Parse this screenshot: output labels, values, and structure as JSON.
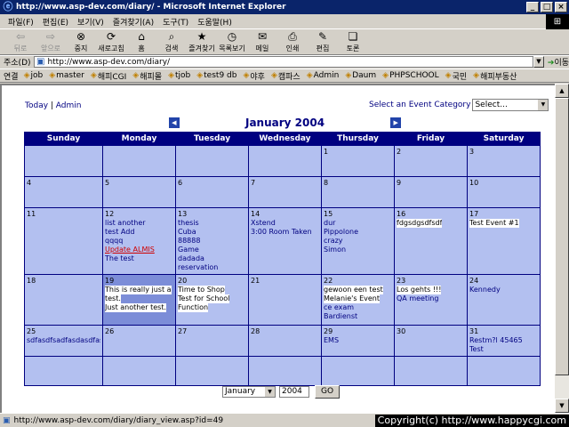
{
  "window": {
    "title": "http://www.asp-dev.com/diary/ - Microsoft Internet Explorer"
  },
  "menu": [
    "파일(F)",
    "편집(E)",
    "보기(V)",
    "즐겨찾기(A)",
    "도구(T)",
    "도움말(H)"
  ],
  "toolbar": [
    {
      "label": "뒤로",
      "icon": "back-arrow-icon",
      "glyph": "⇦",
      "enabled": false
    },
    {
      "label": "앞으로",
      "icon": "forward-arrow-icon",
      "glyph": "⇨",
      "enabled": false
    },
    {
      "label": "중지",
      "icon": "stop-icon",
      "glyph": "⊗",
      "enabled": true
    },
    {
      "label": "새로고침",
      "icon": "refresh-icon",
      "glyph": "⟳",
      "enabled": true
    },
    {
      "label": "홈",
      "icon": "home-icon",
      "glyph": "⌂",
      "enabled": true
    },
    {
      "label": "검색",
      "icon": "search-icon",
      "glyph": "⌕",
      "enabled": true
    },
    {
      "label": "즐겨찾기",
      "icon": "favorites-icon",
      "glyph": "★",
      "enabled": true
    },
    {
      "label": "목록보기",
      "icon": "history-icon",
      "glyph": "◷",
      "enabled": true
    },
    {
      "label": "메일",
      "icon": "mail-icon",
      "glyph": "✉",
      "enabled": true
    },
    {
      "label": "인쇄",
      "icon": "print-icon",
      "glyph": "⎙",
      "enabled": true
    },
    {
      "label": "편집",
      "icon": "edit-icon",
      "glyph": "✎",
      "enabled": true
    },
    {
      "label": "토론",
      "icon": "discuss-icon",
      "glyph": "❏",
      "enabled": true
    }
  ],
  "address": {
    "label": "주소(D)",
    "url": "http://www.asp-dev.com/diary/",
    "go_label": "이동"
  },
  "links": {
    "label": "연결",
    "items": [
      "job",
      "master",
      "해피CGI",
      "해피몰",
      "tjob",
      "test9 db",
      "야후",
      "캠파스",
      "Admin",
      "Daum",
      "PHPSCHOOL",
      "국민",
      "해피부동산"
    ]
  },
  "page": {
    "today_link": "Today",
    "separator": " | ",
    "admin_link": "Admin",
    "category_label": "Select an Event Category",
    "category_value": "Select...",
    "month_title": "January 2004",
    "prev_glyph": "◀",
    "next_glyph": "▶",
    "day_headers": [
      "Sunday",
      "Monday",
      "Tuesday",
      "Wednesday",
      "Thursday",
      "Friday",
      "Saturday"
    ],
    "weeks": [
      [
        {
          "day": "",
          "events": []
        },
        {
          "day": "",
          "events": []
        },
        {
          "day": "",
          "events": []
        },
        {
          "day": "",
          "events": []
        },
        {
          "day": "1",
          "events": []
        },
        {
          "day": "2",
          "events": []
        },
        {
          "day": "3",
          "events": []
        }
      ],
      [
        {
          "day": "4",
          "events": []
        },
        {
          "day": "5",
          "events": []
        },
        {
          "day": "6",
          "events": []
        },
        {
          "day": "7",
          "events": []
        },
        {
          "day": "8",
          "events": []
        },
        {
          "day": "9",
          "events": []
        },
        {
          "day": "10",
          "events": []
        }
      ],
      [
        {
          "day": "11",
          "events": []
        },
        {
          "day": "12",
          "events": [
            {
              "text": "list another"
            },
            {
              "text": "test Add"
            },
            {
              "text": "qqqq"
            },
            {
              "text": "Update ALMIS",
              "style": "red"
            },
            {
              "text": "The test"
            }
          ]
        },
        {
          "day": "13",
          "events": [
            {
              "text": "thesis"
            },
            {
              "text": "Cuba"
            },
            {
              "text": "88888"
            },
            {
              "text": "Game"
            },
            {
              "text": "dadada"
            },
            {
              "text": "reservation"
            }
          ]
        },
        {
          "day": "14",
          "events": [
            {
              "text": "Xstend"
            },
            {
              "text": "3:00 Room Taken"
            }
          ]
        },
        {
          "day": "15",
          "events": [
            {
              "text": "dur"
            },
            {
              "text": "Pippolone"
            },
            {
              "text": "crazy"
            },
            {
              "text": "Simon"
            }
          ]
        },
        {
          "day": "16",
          "events": [
            {
              "text": "fdgsdgsdfsdf",
              "style": "hl"
            }
          ]
        },
        {
          "day": "17",
          "events": [
            {
              "text": "Test Event #1",
              "style": "hl"
            }
          ]
        }
      ],
      [
        {
          "day": "18",
          "events": []
        },
        {
          "day": "19",
          "today": true,
          "events": [
            {
              "text": "This is really just a",
              "style": "hl"
            },
            {
              "text": "test.",
              "style": "hl"
            },
            {
              "text": "Just another test.",
              "style": "hl"
            }
          ]
        },
        {
          "day": "20",
          "events": [
            {
              "text": "Time to Shop",
              "style": "hl"
            },
            {
              "text": "Test for School",
              "style": "hl"
            },
            {
              "text": "Function",
              "style": "hl"
            }
          ]
        },
        {
          "day": "21",
          "events": []
        },
        {
          "day": "22",
          "events": [
            {
              "text": "gewoon een test",
              "style": "hl"
            },
            {
              "text": "Melanie's Event",
              "style": "hl"
            },
            {
              "text": "ce exam"
            },
            {
              "text": "Bardienst"
            }
          ]
        },
        {
          "day": "23",
          "events": [
            {
              "text": "Los gehts !!!",
              "style": "hl"
            },
            {
              "text": "QA meeting"
            }
          ]
        },
        {
          "day": "24",
          "events": [
            {
              "text": "Kennedy"
            }
          ]
        }
      ],
      [
        {
          "day": "25",
          "events": [
            {
              "text": "sdfasdfsadfasdasdfasd"
            }
          ]
        },
        {
          "day": "26",
          "events": []
        },
        {
          "day": "27",
          "events": []
        },
        {
          "day": "28",
          "events": []
        },
        {
          "day": "29",
          "events": [
            {
              "text": "EMS"
            }
          ]
        },
        {
          "day": "30",
          "events": []
        },
        {
          "day": "31",
          "events": [
            {
              "text": "Restm?l 45465"
            },
            {
              "text": "Test"
            }
          ]
        }
      ],
      [
        {
          "day": "",
          "events": []
        },
        {
          "day": "",
          "events": []
        },
        {
          "day": "",
          "events": []
        },
        {
          "day": "",
          "events": []
        },
        {
          "day": "",
          "events": []
        },
        {
          "day": "",
          "events": []
        },
        {
          "day": "",
          "events": []
        }
      ]
    ],
    "bottom": {
      "month_value": "January",
      "year_value": "2004",
      "go_label": "GO"
    }
  },
  "status": {
    "text": "http://www.asp-dev.com/diary/diary_view.asp?id=49",
    "copyright": "Copyright(c) http://www.happycgi.com"
  }
}
